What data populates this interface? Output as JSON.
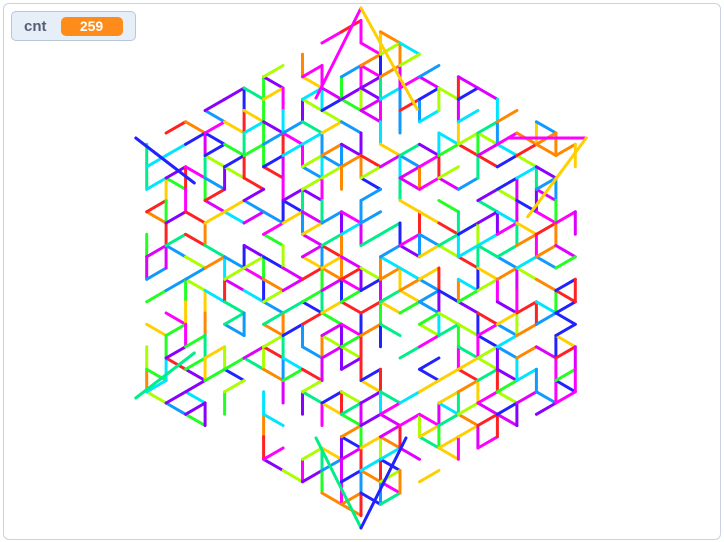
{
  "monitor": {
    "label": "cnt",
    "value": "259",
    "accent": "#ff8c1a"
  },
  "palette": [
    "#ff00ff",
    "#ff2222",
    "#ff8800",
    "#ffd000",
    "#aaff00",
    "#22ff22",
    "#00ee88",
    "#00e5ff",
    "#1199ff",
    "#2222ff",
    "#8800ff",
    "#dd00ff"
  ],
  "stage": {
    "background": "#ffffff",
    "border": "#c9d3e2"
  }
}
